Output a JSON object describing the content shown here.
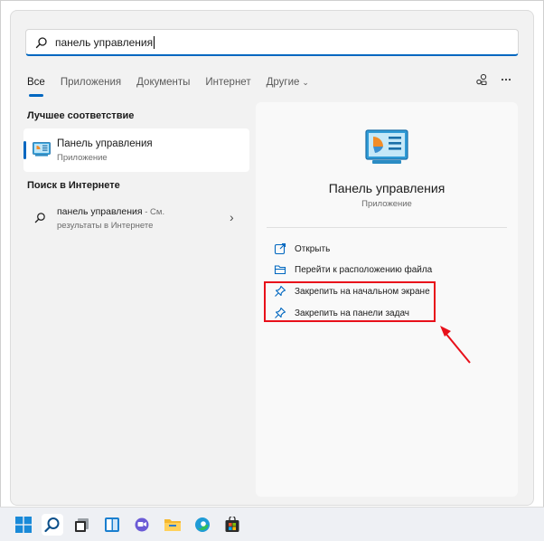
{
  "search": {
    "query": "панель управления",
    "icon": "search-icon"
  },
  "tabs": [
    {
      "label": "Все",
      "active": true
    },
    {
      "label": "Приложения",
      "active": false
    },
    {
      "label": "Документы",
      "active": false
    },
    {
      "label": "Интернет",
      "active": false
    },
    {
      "label": "Другие",
      "active": false,
      "has_dropdown": true
    }
  ],
  "toolbar": {
    "share_icon": "share-icon",
    "more_icon": "more-icon"
  },
  "best_match": {
    "heading": "Лучшее соответствие",
    "title": "Панель управления",
    "subtitle": "Приложение",
    "icon": "control-panel-icon"
  },
  "web_search": {
    "heading": "Поиск в Интернете",
    "query": "панель управления",
    "suffix": " - См.",
    "line2": "результаты в Интернете",
    "icon": "search-icon"
  },
  "details": {
    "title": "Панель управления",
    "subtitle": "Приложение",
    "icon": "control-panel-icon",
    "actions": [
      {
        "label": "Открыть",
        "icon": "open-external-icon"
      },
      {
        "label": "Перейти к расположению файла",
        "icon": "folder-icon"
      },
      {
        "label": "Закрепить на начальном экране",
        "icon": "pin-icon"
      },
      {
        "label": "Закрепить на панели задач",
        "icon": "pin-icon"
      }
    ]
  },
  "taskbar": {
    "items": [
      {
        "name": "start",
        "icon": "windows-start-icon"
      },
      {
        "name": "search",
        "icon": "search-icon",
        "active": true
      },
      {
        "name": "task-view",
        "icon": "task-view-icon"
      },
      {
        "name": "widgets",
        "icon": "widgets-icon"
      },
      {
        "name": "chat",
        "icon": "chat-icon"
      },
      {
        "name": "file-explorer",
        "icon": "folder-icon"
      },
      {
        "name": "edge",
        "icon": "edge-browser-icon"
      },
      {
        "name": "store",
        "icon": "store-icon"
      }
    ]
  },
  "colors": {
    "accent": "#0067c0",
    "highlight": "#e8101a"
  }
}
